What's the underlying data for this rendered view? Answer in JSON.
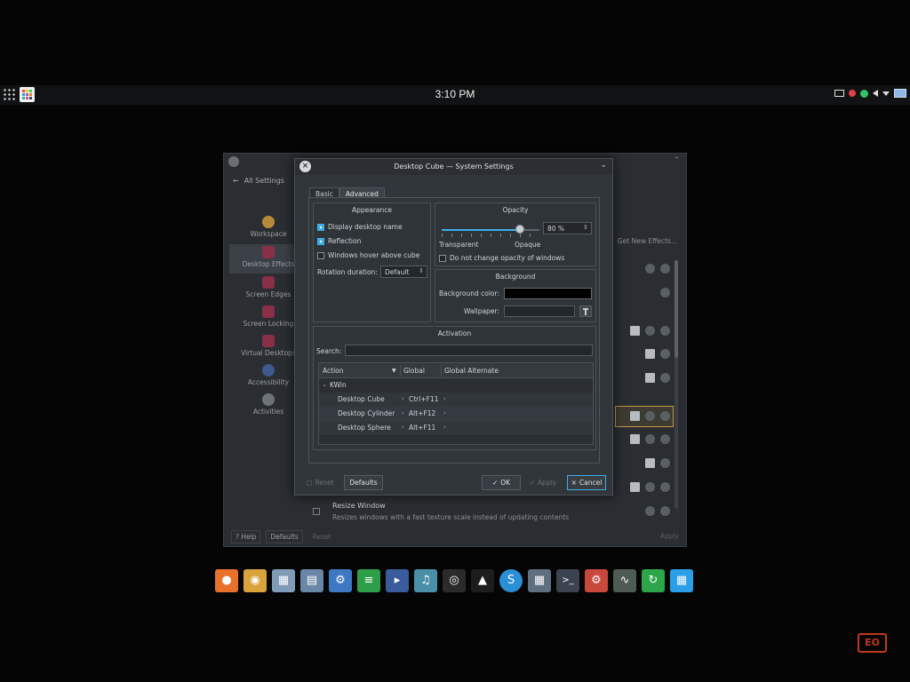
{
  "topbar": {
    "clock": "3:10 PM",
    "icons": [
      "apps-grid-icon",
      "launcher-icon",
      "mail-icon",
      "record-icon",
      "network-icon",
      "volume-icon",
      "tray-expand-icon",
      "screen-icon"
    ]
  },
  "background_window": {
    "back_label": "All Settings",
    "categories": [
      {
        "label": "Workspace",
        "icon": "workspace-icon"
      },
      {
        "label": "Desktop Effects",
        "icon": "desktop-effects-icon"
      },
      {
        "label": "Screen Edges",
        "icon": "screen-edges-icon"
      },
      {
        "label": "Screen Locking",
        "icon": "screen-locking-icon"
      },
      {
        "label": "Virtual Desktops",
        "icon": "virtual-desktops-icon"
      },
      {
        "label": "Accessibility",
        "icon": "accessibility-icon"
      },
      {
        "label": "Activities",
        "icon": "activities-icon"
      }
    ],
    "get_new_effects": "Get New Effects...",
    "effect_title": "Resize Window",
    "effect_desc": "Resizes windows with a fast texture scale instead of updating contents",
    "help_label": "Help",
    "defaults_label": "Defaults",
    "reset_label": "Reset",
    "apply_label": "Apply"
  },
  "dialog": {
    "title": "Desktop Cube — System Settings",
    "tabs": [
      "Basic",
      "Advanced"
    ],
    "active_tab": "Advanced",
    "appearance": {
      "title": "Appearance",
      "display_desktop_name": "Display desktop name",
      "reflection": "Reflection",
      "windows_hover": "Windows hover above cube",
      "rotation_label": "Rotation duration:",
      "rotation_value": "Default"
    },
    "opacity": {
      "title": "Opacity",
      "value": "80 %",
      "level": 0.8,
      "transparent": "Transparent",
      "opaque": "Opaque",
      "no_change": "Do not change opacity of windows"
    },
    "background": {
      "title": "Background",
      "color_label": "Background color:",
      "color_value": "#000000",
      "wallpaper_label": "Wallpaper:"
    },
    "activation": {
      "title": "Activation",
      "search_label": "Search:",
      "search_value": "",
      "columns": [
        "Action",
        "Global",
        "Global Alternate"
      ],
      "group": "KWin",
      "rows": [
        {
          "action": "Desktop Cube",
          "global": "Ctrl+F11"
        },
        {
          "action": "Desktop Cylinder",
          "global": "Alt+F12"
        },
        {
          "action": "Desktop Sphere",
          "global": "Alt+F11"
        }
      ]
    },
    "buttons": {
      "reset": "Reset",
      "defaults": "Defaults",
      "ok": "OK",
      "apply": "Apply",
      "cancel": "Cancel"
    }
  },
  "dock": [
    {
      "name": "firefox-icon",
      "color": "#e8712c"
    },
    {
      "name": "chrome-icon",
      "color": "#d9a23a"
    },
    {
      "name": "files-icon",
      "color": "#7f9bb8"
    },
    {
      "name": "file-manager-icon",
      "color": "#6a86a6"
    },
    {
      "name": "settings-icon",
      "color": "#3e78c2"
    },
    {
      "name": "spotify-icon",
      "color": "#2f9e48"
    },
    {
      "name": "video-editor-icon",
      "color": "#3b5c9c"
    },
    {
      "name": "audio-icon",
      "color": "#4a8fa8"
    },
    {
      "name": "obs-icon",
      "color": "#2b2b2b"
    },
    {
      "name": "linux-icon",
      "color": "#1d1d1d"
    },
    {
      "name": "skype-icon",
      "color": "#2a8fd4"
    },
    {
      "name": "calculator-icon",
      "color": "#5e6f80"
    },
    {
      "name": "terminal-icon",
      "color": "#3b4250"
    },
    {
      "name": "system-settings-icon",
      "color": "#c9483e"
    },
    {
      "name": "monitor-icon",
      "color": "#4d5b52"
    },
    {
      "name": "update-icon",
      "color": "#2da64a"
    },
    {
      "name": "windows-icon",
      "color": "#2a9ee6"
    }
  ],
  "watermark": "EO"
}
